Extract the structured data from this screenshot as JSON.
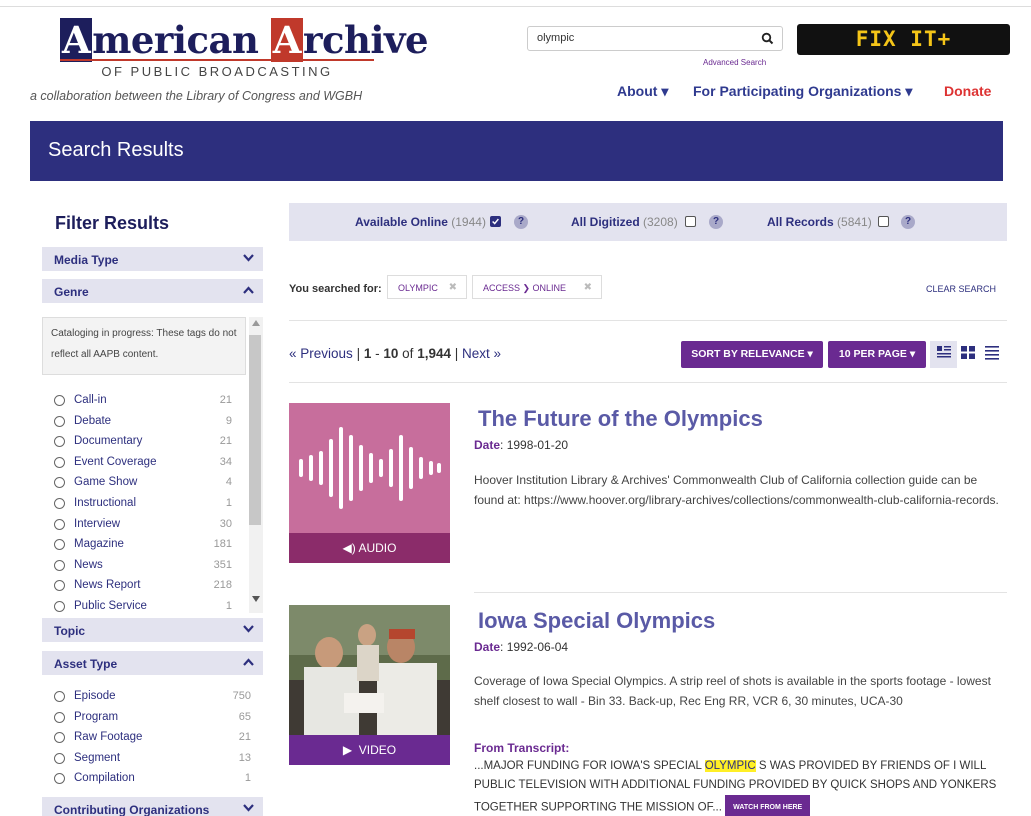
{
  "header": {
    "logo_initial_1": "A",
    "logo_word_1": "merican",
    "logo_initial_2": "A",
    "logo_word_2": "rchive",
    "logo_sub": "OF PUBLIC BROADCASTING",
    "tagline": "a collaboration between the Library of Congress and WGBH",
    "search_value": "olympic",
    "advanced_search": "Advanced Search",
    "fixit_label": "FIX IT+",
    "nav": {
      "about": "About ▾",
      "organizations": "For Participating Organizations ▾",
      "donate": "Donate"
    }
  },
  "banner": {
    "title": "Search Results"
  },
  "sidebar": {
    "title": "Filter Results",
    "facets": {
      "media_type": "Media Type",
      "genre": "Genre",
      "topic": "Topic",
      "asset_type": "Asset Type",
      "contributing": "Contributing Organizations"
    },
    "genre_notice": "Cataloging in progress: These tags do not reflect all AAPB content.",
    "genre_items": [
      {
        "label": "Call-in",
        "count": "21"
      },
      {
        "label": "Debate",
        "count": "9"
      },
      {
        "label": "Documentary",
        "count": "21"
      },
      {
        "label": "Event Coverage",
        "count": "34"
      },
      {
        "label": "Game Show",
        "count": "4"
      },
      {
        "label": "Instructional",
        "count": "1"
      },
      {
        "label": "Interview",
        "count": "30"
      },
      {
        "label": "Magazine",
        "count": "181"
      },
      {
        "label": "News",
        "count": "351"
      },
      {
        "label": "News Report",
        "count": "218"
      },
      {
        "label": "Public Service",
        "count": "1"
      }
    ],
    "asset_items": [
      {
        "label": "Episode",
        "count": "750"
      },
      {
        "label": "Program",
        "count": "65"
      },
      {
        "label": "Raw Footage",
        "count": "21"
      },
      {
        "label": "Segment",
        "count": "13"
      },
      {
        "label": "Compilation",
        "count": "1"
      }
    ]
  },
  "access_bar": {
    "online_label": "Available Online",
    "online_count": "(1944)",
    "digitized_label": "All Digitized",
    "digitized_count": "(3208)",
    "records_label": "All Records",
    "records_count": "(5841)",
    "help": "?"
  },
  "query": {
    "searched_for": "You searched for:",
    "chip_1": "OLYMPIC",
    "chip_2": "ACCESS ❯ ONLINE",
    "chip_x": "✖",
    "clear": "CLEAR SEARCH"
  },
  "pager": {
    "previous": "« Previous",
    "range_start": "1",
    "range_end": "10",
    "of": "of",
    "total": "1,944",
    "next": "Next »",
    "sort": "SORT BY RELEVANCE ▾",
    "per_page": "10 PER PAGE ▾"
  },
  "results": [
    {
      "title": "The Future of the Olympics",
      "date_label": "Date",
      "date": "1998-01-20",
      "description": "Hoover Institution Library & Archives' Commonwealth Club of California collection guide can be found at: https://www.hoover.org/library-archives/collections/commonwealth-club-california-records.",
      "media": "AUDIO"
    },
    {
      "title": "Iowa Special Olympics",
      "date_label": "Date",
      "date": "1992-06-04",
      "description": "Coverage of Iowa Special Olympics. A strip reel of shots is available in the sports footage - lowest shelf closest to wall - Bin 33. Back-up, Rec Eng RR, VCR 6, 30 minutes, UCA-30",
      "media": "VIDEO",
      "transcript_label": "From Transcript",
      "transcript_before": "...MAJOR FUNDING FOR IOWA'S SPECIAL ",
      "transcript_highlight": "OLYMPIC",
      "transcript_after": " S WAS PROVIDED BY FRIENDS OF I WILL PUBLIC TELEVISION WITH ADDITIONAL FUNDING PROVIDED BY QUICK SHOPS AND YONKERS TOGETHER SUPPORTING THE MISSION OF... ",
      "watch": "WATCH FROM HERE"
    }
  ],
  "colors": {
    "navy": "#2d2f7e",
    "purple": "#6a2a91",
    "donate": "#dd3333",
    "audio_thumb": "#c76e9c",
    "highlight": "#ffef26"
  }
}
